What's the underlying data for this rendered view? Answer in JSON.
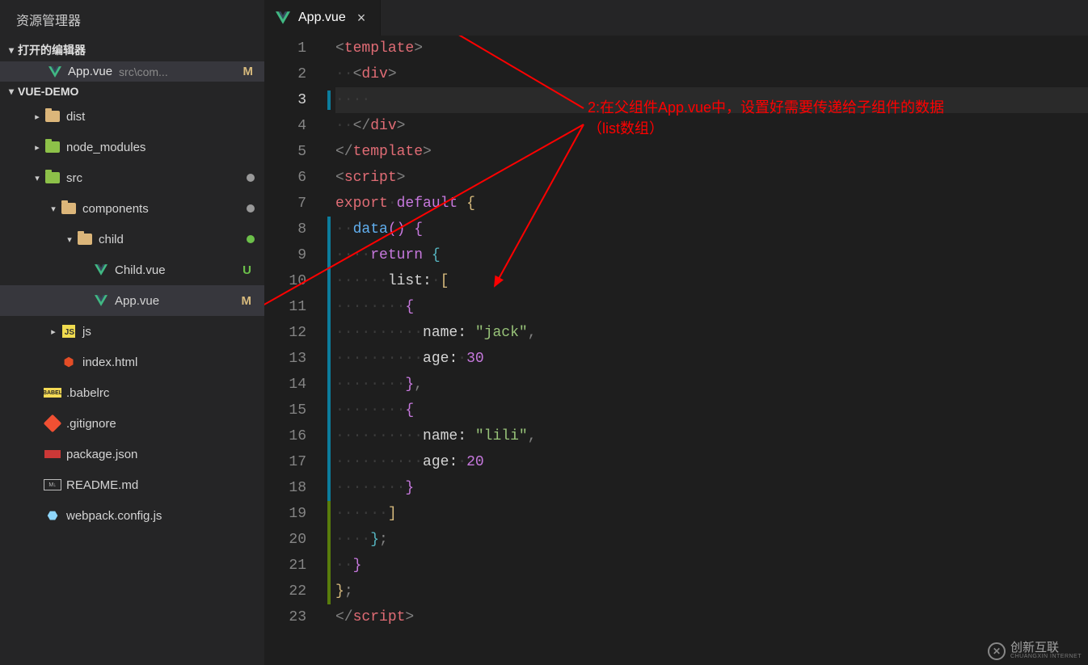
{
  "sidebar": {
    "title": "资源管理器",
    "open_editors_header": "打开的编辑器",
    "open_editor": {
      "filename": "App.vue",
      "path": "src\\com...",
      "badge": "M"
    },
    "project_header": "VUE-DEMO",
    "tree": [
      {
        "id": "dist",
        "label": "dist",
        "indent": 0,
        "kind": "folder-closed",
        "icon": "folder",
        "chev": "right"
      },
      {
        "id": "node_modules",
        "label": "node_modules",
        "indent": 0,
        "kind": "folder-closed",
        "icon": "folder-green",
        "chev": "right"
      },
      {
        "id": "src",
        "label": "src",
        "indent": 0,
        "kind": "folder-open",
        "icon": "folder-green",
        "chev": "down",
        "dot": "gray"
      },
      {
        "id": "components",
        "label": "components",
        "indent": 1,
        "kind": "folder-open",
        "icon": "folder",
        "chev": "down",
        "dot": "gray"
      },
      {
        "id": "child",
        "label": "child",
        "indent": 2,
        "kind": "folder-open",
        "icon": "folder",
        "chev": "down",
        "dot": "green"
      },
      {
        "id": "childvue",
        "label": "Child.vue",
        "indent": 3,
        "kind": "file",
        "icon": "vue",
        "letter": "U"
      },
      {
        "id": "appvue",
        "label": "App.vue",
        "indent": 3,
        "kind": "file",
        "icon": "vue",
        "letter": "M",
        "selected": true
      },
      {
        "id": "js",
        "label": "js",
        "indent": 1,
        "kind": "folder-closed",
        "icon": "js",
        "chev": "right"
      },
      {
        "id": "indexhtml",
        "label": "index.html",
        "indent": 1,
        "kind": "file",
        "icon": "html5"
      },
      {
        "id": "babelrc",
        "label": ".babelrc",
        "indent": 0,
        "kind": "file",
        "icon": "babel"
      },
      {
        "id": "gitignore",
        "label": ".gitignore",
        "indent": 0,
        "kind": "file",
        "icon": "git"
      },
      {
        "id": "package",
        "label": "package.json",
        "indent": 0,
        "kind": "file",
        "icon": "npm"
      },
      {
        "id": "readme",
        "label": "README.md",
        "indent": 0,
        "kind": "file",
        "icon": "md"
      },
      {
        "id": "webpack",
        "label": "webpack.config.js",
        "indent": 0,
        "kind": "file",
        "icon": "webpack"
      }
    ]
  },
  "tab": {
    "filename": "App.vue"
  },
  "annotation": {
    "line1": "2:在父组件App.vue中，设置好需要传递给子组件的数据",
    "line2": "（list数组）"
  },
  "watermark": {
    "brand": "创新互联",
    "sub": "CHUANGXIN INTERNET"
  },
  "code": {
    "lines": [
      {
        "n": 1,
        "html": "<span class='tk-punc'>&lt;</span><span class='tk-tag'>template</span><span class='tk-punc'>&gt;</span>"
      },
      {
        "n": 2,
        "html": "<span class='ig'>··</span><span class='tk-punc'>&lt;</span><span class='tk-tag'>div</span><span class='tk-punc'>&gt;</span>"
      },
      {
        "n": 3,
        "html": "<span class='ig'>····</span>",
        "current": true,
        "mod": "blue"
      },
      {
        "n": 4,
        "html": "<span class='ig'>··</span><span class='tk-punc'>&lt;/</span><span class='tk-tag'>div</span><span class='tk-punc'>&gt;</span>"
      },
      {
        "n": 5,
        "html": "<span class='tk-punc'>&lt;/</span><span class='tk-tag'>template</span><span class='tk-punc'>&gt;</span>"
      },
      {
        "n": 6,
        "html": "<span class='tk-punc'>&lt;</span><span class='tk-tag'>script</span><span class='tk-punc'>&gt;</span>"
      },
      {
        "n": 7,
        "html": "<span class='tk-kw1'>export</span><span class='ig'>·</span><span class='tk-kw2'>default</span> <span class='tk-br-y'>{</span>"
      },
      {
        "n": 8,
        "html": "<span class='ig'>··</span><span class='tk-fn'>data</span><span class='tk-br-p'>()</span> <span class='tk-br-p'>{</span>",
        "mod": "blue",
        "modStart": true
      },
      {
        "n": 9,
        "html": "<span class='ig'>····</span><span class='tk-kw2'>return</span> <span class='tk-br-b'>{</span>"
      },
      {
        "n": 10,
        "html": "<span class='ig'>······</span><span class='tk-list'>list</span><span class='tk-colon'>:</span><span class='ig'>·</span><span class='tk-br-y'>[</span>"
      },
      {
        "n": 11,
        "html": "<span class='ig'>········</span><span class='tk-br-p'>{</span>"
      },
      {
        "n": 12,
        "html": "<span class='ig'>··········</span><span class='tk-key'>name</span><span class='tk-colon'>:</span> <span class='tk-str'>\"jack\"</span><span class='tk-punc'>,</span>"
      },
      {
        "n": 13,
        "html": "<span class='ig'>··········</span><span class='tk-key'>age</span><span class='tk-colon'>:</span><span class='ig'>·</span><span class='tk-num'>30</span>"
      },
      {
        "n": 14,
        "html": "<span class='ig'>········</span><span class='tk-br-p'>}</span><span class='tk-punc'>,</span>"
      },
      {
        "n": 15,
        "html": "<span class='ig'>········</span><span class='tk-br-p'>{</span>"
      },
      {
        "n": 16,
        "html": "<span class='ig'>··········</span><span class='tk-key'>name</span><span class='tk-colon'>:</span> <span class='tk-str'>\"lili\"</span><span class='tk-punc'>,</span>"
      },
      {
        "n": 17,
        "html": "<span class='ig'>··········</span><span class='tk-key'>age</span><span class='tk-colon'>:</span><span class='ig'>·</span><span class='tk-num'>20</span>"
      },
      {
        "n": 18,
        "html": "<span class='ig'>········</span><span class='tk-br-p'>}</span>",
        "mod": "blue",
        "modEnd": true
      },
      {
        "n": 19,
        "html": "<span class='ig'>······</span><span class='tk-br-y'>]</span>",
        "mod": "green",
        "modStart": true
      },
      {
        "n": 20,
        "html": "<span class='ig'>····</span><span class='tk-br-b'>}</span><span class='tk-punc'>;</span>"
      },
      {
        "n": 21,
        "html": "<span class='ig'>··</span><span class='tk-br-p'>}</span>"
      },
      {
        "n": 22,
        "html": "<span class='tk-br-y'>}</span><span class='tk-punc'>;</span>",
        "mod": "green",
        "modEnd": true
      },
      {
        "n": 23,
        "html": "<span class='tk-punc'>&lt;/</span><span class='tk-tag'>script</span><span class='tk-punc'>&gt;</span>"
      }
    ]
  }
}
